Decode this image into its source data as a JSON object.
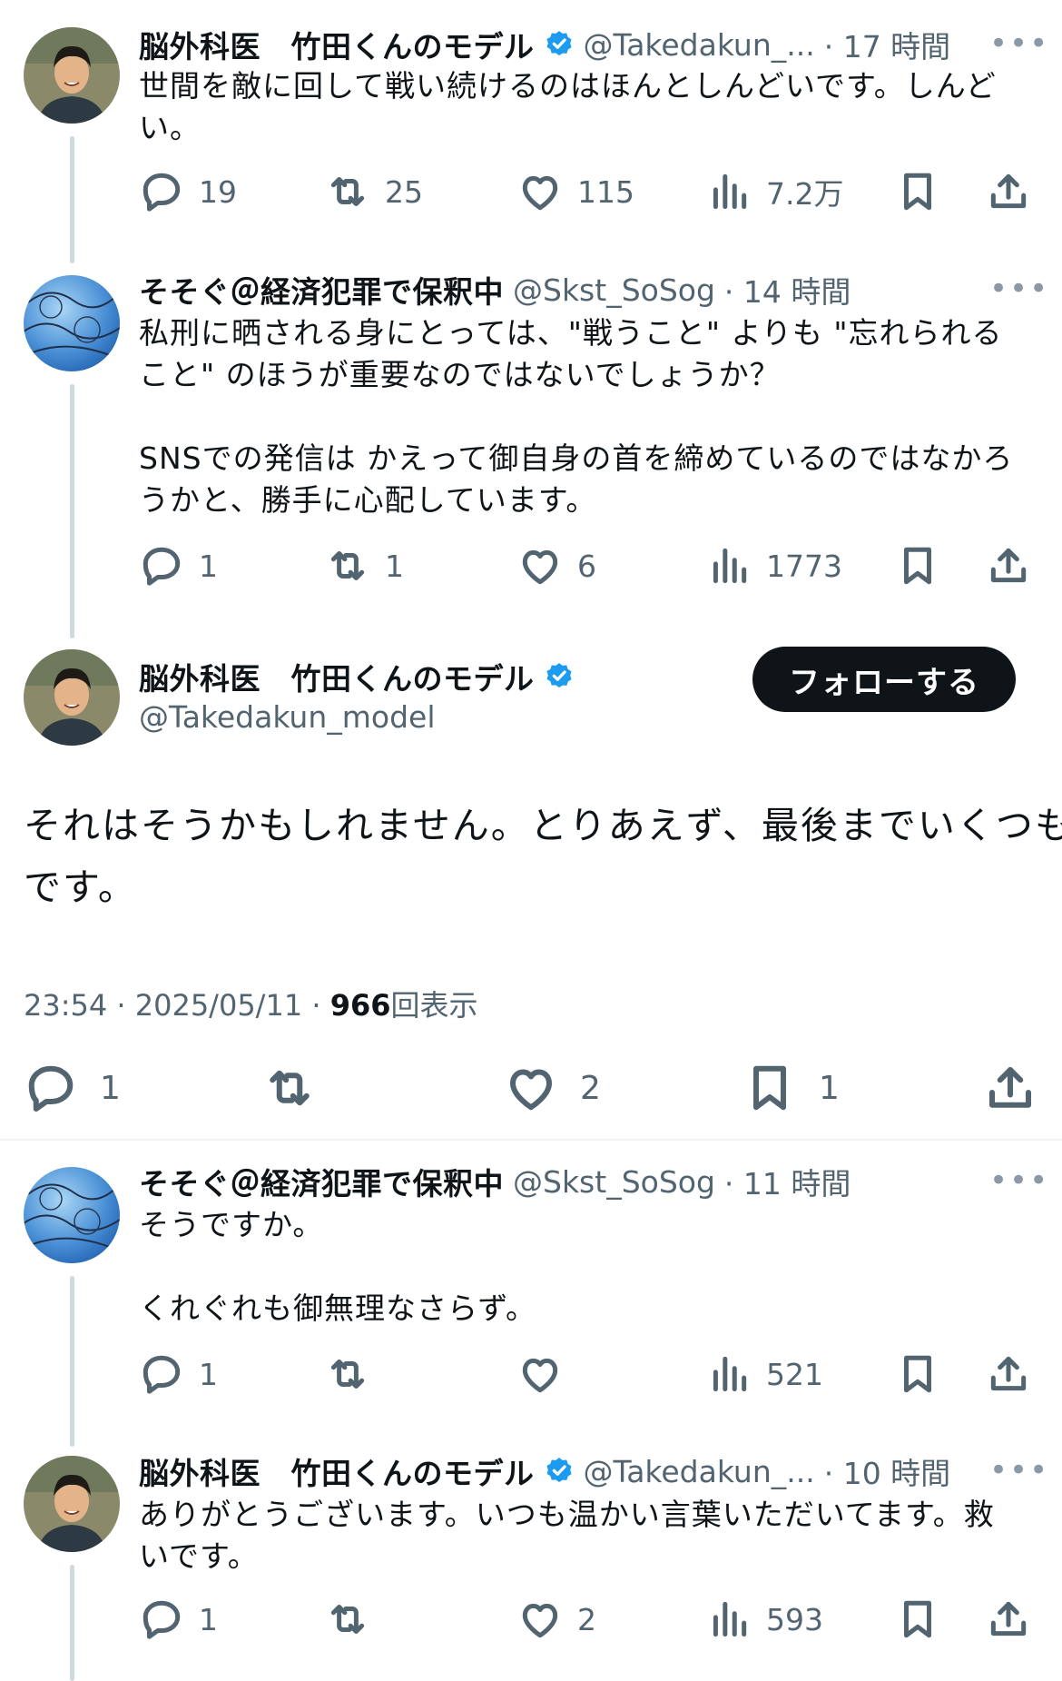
{
  "reply1": {
    "author": "脳外科医　竹田くんのモデル",
    "handle": "@Takedakun_...",
    "time": "· 17 時間",
    "text_lines": [
      "世間を敵に回して戦い続けるのはほんとしんどいです。しんど",
      "い。"
    ],
    "stats": {
      "replies": "19",
      "retweets": "25",
      "likes": "115",
      "views": "7.2万"
    }
  },
  "reply2": {
    "author": "そそぐ＠経済犯罪で保釈中",
    "handle": "@Skst_SoSog",
    "time": "· 14 時間",
    "text_lines": [
      "私刑に晒される身にとっては、\"戦うこと\" よりも \"忘れられる",
      "こと\" のほうが重要なのではないでしょうか？",
      "",
      "SNSでの発信は かえって御自身の首を締めているのではなかろ",
      "うかと、勝手に心配しています。"
    ],
    "stats": {
      "replies": "1",
      "retweets": "1",
      "likes": "6",
      "views": "1773"
    }
  },
  "main": {
    "author": "脳外科医　竹田くんのモデル",
    "handle": "@Takedakun_model",
    "follow_label": "フォローする",
    "text_lines": [
      "それはそうかもしれません。とりあえず、最後までいくつもり",
      "です。"
    ],
    "timestamp": "23:54 · 2025/05/11 · ",
    "view_count": "966",
    "view_label": "回表示",
    "stats": {
      "replies": "1",
      "likes": "2",
      "bookmarks": "1"
    }
  },
  "reply3": {
    "author": "そそぐ＠経済犯罪で保釈中",
    "handle": "@Skst_SoSog",
    "time": "· 11 時間",
    "text_lines": [
      "そうですか。",
      "",
      "くれぐれも御無理なさらず。"
    ],
    "stats": {
      "replies": "1",
      "views": "521"
    }
  },
  "reply4": {
    "author": "脳外科医　竹田くんのモデル",
    "handle": "@Takedakun_...",
    "time": "· 10 時間",
    "text_lines": [
      "ありがとうございます。いつも温かい言葉いただいてます。救",
      "いです。"
    ],
    "stats": {
      "replies": "1",
      "likes": "2",
      "views": "593"
    }
  },
  "more_label": "•••",
  "colors": {
    "accent": "#1d9bf0",
    "muted": "#536471",
    "thread": "#cfd9de",
    "button": "#0f1419"
  },
  "icons": [
    "reply-icon",
    "retweet-icon",
    "like-icon",
    "views-icon",
    "bookmark-icon",
    "share-icon",
    "verified-badge-icon"
  ]
}
